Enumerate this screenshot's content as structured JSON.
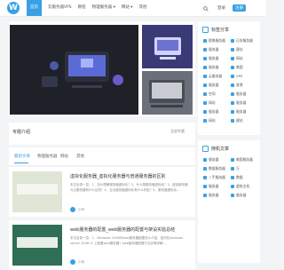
{
  "header": {
    "logo_letter": "W",
    "nav": [
      {
        "label": "首页",
        "active": true
      },
      {
        "label": "云服务器VPS",
        "active": false
      },
      {
        "label": "教程",
        "active": false
      },
      {
        "label": "物理服务器 ▾",
        "active": false
      },
      {
        "label": "网站 ▾",
        "active": false
      },
      {
        "label": "其他",
        "active": false
      }
    ],
    "login": "登录",
    "register": "注册"
  },
  "topic": {
    "title": "专题介绍",
    "more": "全部专题"
  },
  "tabs": [
    "最新文章",
    "物理服务器",
    "网站",
    "其他"
  ],
  "posts": [
    {
      "title": "虚拟化服务器_虚拟化服务器与普通服务器的区别",
      "excerpt": "本文目录一览：1、怎么理解服务器虚拟化？2、什么是服务器虚拟化？3、虚拟服务器与云服务器有什么区别？4、企业服务器虚拟化有什么好处？5、服务器虚拟化...",
      "author": "小明"
    },
    {
      "title": "web服务器的配置_web服务器的配置与架设实验总结",
      "excerpt": "本文目录一览：1、Windows 2008中web服务器配置怎么介绍，如何在windows server 2008 r2 上配置web服务器？web服务器配置方法步骤详解...",
      "author": "小明"
    }
  ],
  "sidebar": {
    "tags_title": "标签分享",
    "tags": [
      "欧美服务器",
      "日本服务器",
      "服务器",
      "建站",
      "服务器",
      "网站",
      "服务器",
      "美国",
      "云服务器",
      "VPS",
      "服务器",
      "香港",
      "空间",
      "服务器",
      "网站",
      "服务器",
      "服务器",
      "服务器",
      "网站",
      "建站"
    ],
    "articles_title": "随机文章",
    "articles": [
      "服务器",
      "美国服务器",
      "数据服务器",
      "万",
      "二手服务器",
      "数据",
      "服务器",
      "虚拟主机",
      "服务器",
      "服务器"
    ]
  },
  "colors": {
    "accent": "#3aa0e5",
    "background": "#f3f4f6"
  }
}
